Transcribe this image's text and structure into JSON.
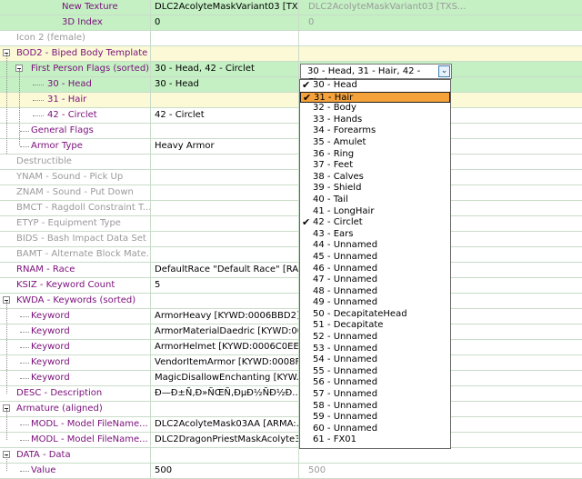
{
  "rows": [
    {
      "label": "New Texture",
      "value": "DLC2AcolyteMaskVariant03 [TXS...",
      "value2": "DLC2AcolyteMaskVariant03 [TXS...",
      "style": "purple",
      "bg": "green"
    },
    {
      "label": "3D Index",
      "value": "0",
      "value2": "0",
      "style": "purple",
      "bg": "green"
    },
    {
      "label": "Icon 2 (female)",
      "value": "",
      "value2": "",
      "style": "gray",
      "bg": ""
    },
    {
      "label": "BOD2 - Biped Body Template",
      "value": "",
      "value2": "",
      "style": "purple",
      "bg": "yellow"
    },
    {
      "label": "First Person Flags (sorted)",
      "value": "30 - Head, 42 - Circlet",
      "value2": "",
      "style": "purple",
      "bg": "green"
    },
    {
      "label": "30 - Head",
      "value": "30 - Head",
      "value2": "",
      "style": "purple",
      "bg": "green"
    },
    {
      "label": "31 - Hair",
      "value": "",
      "value2": "",
      "style": "purple",
      "bg": "yellow"
    },
    {
      "label": "42 - Circlet",
      "value": "42 - Circlet",
      "value2": "",
      "style": "purple",
      "bg": ""
    },
    {
      "label": "General Flags",
      "value": "",
      "value2": "",
      "style": "purple",
      "bg": ""
    },
    {
      "label": "Armor Type",
      "value": "Heavy Armor",
      "value2": "",
      "style": "purple",
      "bg": ""
    },
    {
      "label": "Destructible",
      "value": "",
      "value2": "",
      "style": "gray",
      "bg": ""
    },
    {
      "label": "YNAM - Sound - Pick Up",
      "value": "",
      "value2": "",
      "style": "gray",
      "bg": ""
    },
    {
      "label": "ZNAM - Sound - Put Down",
      "value": "",
      "value2": "",
      "style": "gray",
      "bg": ""
    },
    {
      "label": "BMCT - Ragdoll Constraint T...",
      "value": "",
      "value2": "",
      "style": "gray",
      "bg": ""
    },
    {
      "label": "ETYP - Equipment Type",
      "value": "",
      "value2": "",
      "style": "gray",
      "bg": ""
    },
    {
      "label": "BIDS - Bash Impact Data Set",
      "value": "",
      "value2": "",
      "style": "gray",
      "bg": ""
    },
    {
      "label": "BAMT - Alternate Block Mate...",
      "value": "",
      "value2": "",
      "style": "gray",
      "bg": ""
    },
    {
      "label": "RNAM - Race",
      "value": "DefaultRace \"Default Race\" [RAC...",
      "value2": "",
      "style": "purple",
      "bg": ""
    },
    {
      "label": "KSIZ - Keyword Count",
      "value": "5",
      "value2": "",
      "style": "purple",
      "bg": ""
    },
    {
      "label": "KWDA - Keywords (sorted)",
      "value": "",
      "value2": "",
      "style": "purple",
      "bg": ""
    },
    {
      "label": "Keyword",
      "value": "ArmorHeavy [KYWD:0006BBD2]",
      "value2": "",
      "style": "purple",
      "bg": ""
    },
    {
      "label": "Keyword",
      "value": "ArmorMaterialDaedric [KYWD:00...",
      "value2": "",
      "style": "purple",
      "bg": ""
    },
    {
      "label": "Keyword",
      "value": "ArmorHelmet [KYWD:0006C0EE]",
      "value2": "",
      "style": "purple",
      "bg": ""
    },
    {
      "label": "Keyword",
      "value": "VendorItemArmor [KYWD:0008F...",
      "value2": "",
      "style": "purple",
      "bg": ""
    },
    {
      "label": "Keyword",
      "value": "MagicDisallowEnchanting [KYW...",
      "value2": "",
      "style": "purple",
      "bg": ""
    },
    {
      "label": "DESC - Description",
      "value": "Ð—Ð±Ñ‚Ð»ÑŒÑ‚ÐµÐ½ÑÐ½Ð...",
      "value2": "",
      "style": "purple",
      "bg": ""
    },
    {
      "label": "Armature (aligned)",
      "value": "",
      "value2": "",
      "style": "purple",
      "bg": ""
    },
    {
      "label": "MODL - Model FileName...",
      "value": "DLC2AcolyteMask03AA [ARMA:...",
      "value2": "",
      "style": "purple",
      "bg": ""
    },
    {
      "label": "MODL - Model FileName...",
      "value": "DLC2DragonPriestMaskAcolyte3...",
      "value2": "",
      "style": "purple",
      "bg": ""
    },
    {
      "label": "DATA - Data",
      "value": "",
      "value2": "",
      "style": "purple",
      "bg": ""
    },
    {
      "label": "Value",
      "value": "500",
      "value2": "500",
      "style": "purple",
      "bg": ""
    }
  ],
  "combo": {
    "value": "30 - Head, 31 - Hair, 42 - Circlet",
    "button_glyph": "⌄"
  },
  "options": [
    {
      "label": "30 - Head",
      "checked": true,
      "selected": false
    },
    {
      "label": "31 - Hair",
      "checked": true,
      "selected": true
    },
    {
      "label": "32 - Body",
      "checked": false,
      "selected": false
    },
    {
      "label": "33 - Hands",
      "checked": false,
      "selected": false
    },
    {
      "label": "34 - Forearms",
      "checked": false,
      "selected": false
    },
    {
      "label": "35 - Amulet",
      "checked": false,
      "selected": false
    },
    {
      "label": "36 - Ring",
      "checked": false,
      "selected": false
    },
    {
      "label": "37 - Feet",
      "checked": false,
      "selected": false
    },
    {
      "label": "38 - Calves",
      "checked": false,
      "selected": false
    },
    {
      "label": "39 - Shield",
      "checked": false,
      "selected": false
    },
    {
      "label": "40 - Tail",
      "checked": false,
      "selected": false
    },
    {
      "label": "41 - LongHair",
      "checked": false,
      "selected": false
    },
    {
      "label": "42 - Circlet",
      "checked": true,
      "selected": false
    },
    {
      "label": "43 - Ears",
      "checked": false,
      "selected": false
    },
    {
      "label": "44 - Unnamed",
      "checked": false,
      "selected": false
    },
    {
      "label": "45 - Unnamed",
      "checked": false,
      "selected": false
    },
    {
      "label": "46 - Unnamed",
      "checked": false,
      "selected": false
    },
    {
      "label": "47 - Unnamed",
      "checked": false,
      "selected": false
    },
    {
      "label": "48 - Unnamed",
      "checked": false,
      "selected": false
    },
    {
      "label": "49 - Unnamed",
      "checked": false,
      "selected": false
    },
    {
      "label": "50 - DecapitateHead",
      "checked": false,
      "selected": false
    },
    {
      "label": "51 - Decapitate",
      "checked": false,
      "selected": false
    },
    {
      "label": "52 - Unnamed",
      "checked": false,
      "selected": false
    },
    {
      "label": "53 - Unnamed",
      "checked": false,
      "selected": false
    },
    {
      "label": "54 - Unnamed",
      "checked": false,
      "selected": false
    },
    {
      "label": "55 - Unnamed",
      "checked": false,
      "selected": false
    },
    {
      "label": "56 - Unnamed",
      "checked": false,
      "selected": false
    },
    {
      "label": "57 - Unnamed",
      "checked": false,
      "selected": false
    },
    {
      "label": "58 - Unnamed",
      "checked": false,
      "selected": false
    },
    {
      "label": "59 - Unnamed",
      "checked": false,
      "selected": false
    },
    {
      "label": "60 - Unnamed",
      "checked": false,
      "selected": false
    },
    {
      "label": "61 - FX01",
      "checked": false,
      "selected": false
    }
  ],
  "colors": {
    "label_purple": "#7a0f7a",
    "label_gray": "#9a9a9a",
    "row_green": "#c4f0c4",
    "row_yellow": "#fbf9d6",
    "selected_orange": "#f5a23b"
  }
}
